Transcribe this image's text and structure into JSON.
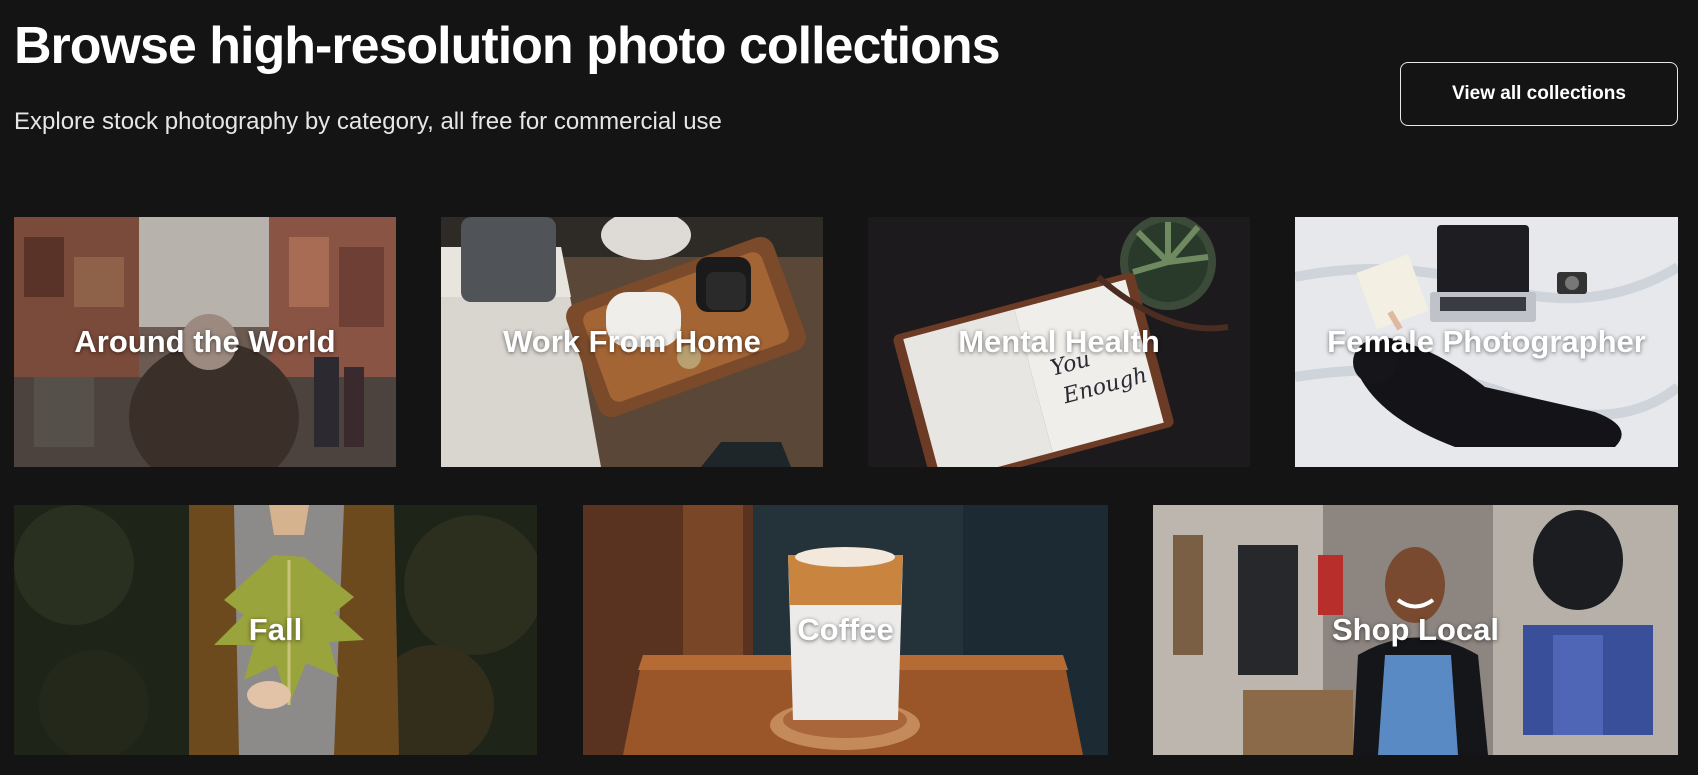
{
  "header": {
    "title": "Browse high-resolution photo collections",
    "subtitle": "Explore stock photography by category, all free for commercial use",
    "view_all_label": "View all collections"
  },
  "collections": [
    {
      "label": "Around the World"
    },
    {
      "label": "Work From Home"
    },
    {
      "label": "Mental Health"
    },
    {
      "label": "Female Photographer"
    },
    {
      "label": "Fall"
    },
    {
      "label": "Coffee"
    },
    {
      "label": "Shop Local"
    }
  ],
  "colors": {
    "background": "#141414",
    "text": "#ffffff",
    "button_border": "#e8e8e8"
  }
}
